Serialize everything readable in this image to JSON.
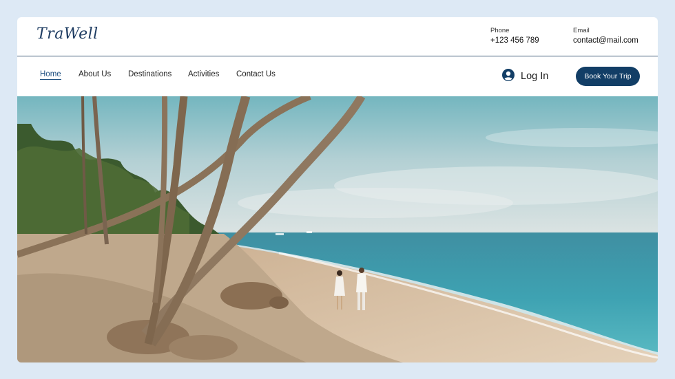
{
  "brand": {
    "logo_text": "TraWell"
  },
  "contact": {
    "phone_label": "Phone",
    "phone_value": "+123 456 789",
    "email_label": "Email",
    "email_value": "contact@mail.com"
  },
  "nav": {
    "items": [
      {
        "label": "Home",
        "active": true
      },
      {
        "label": "About Us"
      },
      {
        "label": "Destinations"
      },
      {
        "label": "Activities"
      },
      {
        "label": "Contact Us"
      }
    ]
  },
  "auth": {
    "login_label": "Log In",
    "login_icon": "user-circle-icon"
  },
  "cta": {
    "book_label": "Book Your Trip"
  },
  "colors": {
    "page_bg": "#dde9f5",
    "accent": "#123e66",
    "logo": "#1e3c62",
    "nav_active": "#1e4f80"
  },
  "hero": {
    "image_subject": "beach-couple-palms"
  }
}
